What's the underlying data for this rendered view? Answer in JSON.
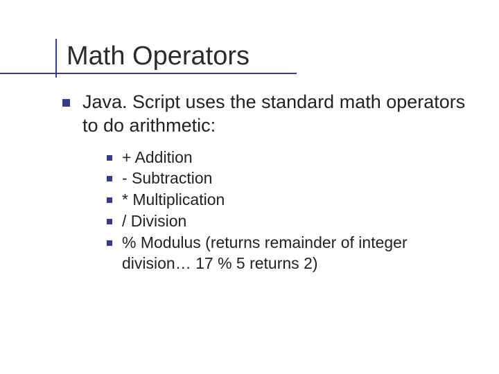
{
  "title": "Math Operators",
  "main_bullet": "Java. Script uses the standard math operators to do arithmetic:",
  "sub_bullets": [
    "+  Addition",
    "-  Subtraction",
    "*  Multiplication",
    "/  Division",
    "% Modulus (returns remainder of integer division… 17 % 5 returns 2)"
  ]
}
